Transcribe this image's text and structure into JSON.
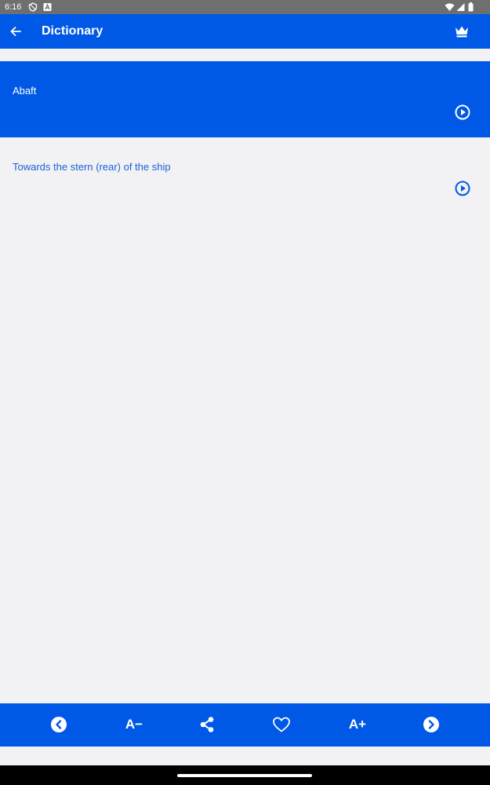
{
  "status_bar": {
    "time": "6:16",
    "icons": [
      "vpn-icon",
      "a-badge-icon",
      "wifi-icon",
      "signal-icon",
      "battery-icon"
    ]
  },
  "app_bar": {
    "title": "Dictionary",
    "back_icon": "arrow-left-icon",
    "premium_icon": "crown-icon"
  },
  "entry": {
    "word": "Abaft",
    "definition": "Towards the stern (rear) of the ship"
  },
  "bottom_toolbar": {
    "items": [
      {
        "name": "previous",
        "icon": "chevron-left-circle-icon"
      },
      {
        "name": "decrease-font",
        "label": "A−"
      },
      {
        "name": "share",
        "icon": "share-icon"
      },
      {
        "name": "favorite",
        "icon": "heart-outline-icon"
      },
      {
        "name": "increase-font",
        "label": "A+"
      },
      {
        "name": "next",
        "icon": "chevron-right-circle-icon"
      }
    ]
  },
  "colors": {
    "primary": "#0059e6",
    "background": "#f2f2f4",
    "definition_text": "#1a62d6",
    "status_bar": "#6f6f6f"
  }
}
